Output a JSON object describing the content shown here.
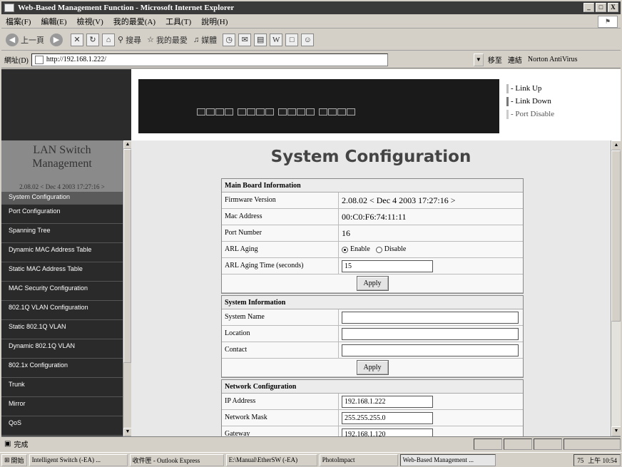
{
  "window": {
    "title": "Web-Based Management Function - Microsoft Internet Explorer",
    "controls": [
      "_",
      "□",
      "X"
    ]
  },
  "menu": [
    "檔案(F)",
    "編輯(E)",
    "檢視(V)",
    "我的最愛(A)",
    "工具(T)",
    "說明(H)"
  ],
  "toolbar": {
    "back": "上一頁",
    "search": "搜尋",
    "favorites": "我的最愛",
    "media": "媒體"
  },
  "address": {
    "label": "網址(D)",
    "url": "http://192.168.1.222/",
    "go": "移至",
    "links": "連結",
    "antivirus": "Norton AntiVirus"
  },
  "banner": {
    "legend": [
      "- Link Up",
      "- Link Down",
      "- Port Disable"
    ],
    "legend_colors": [
      "#cccccc",
      "#888888",
      "#bbbbbb"
    ]
  },
  "nav": {
    "title_line1": "LAN Switch",
    "title_line2": "Management",
    "version": "2.08.02 < Dec 4 2003 17:27:16 >",
    "items": [
      "System Configuration",
      "Port Configuration",
      "Spanning Tree",
      "Dynamic MAC Address Table",
      "Static MAC Address Table",
      "MAC Security Configuration",
      "802.1Q VLAN Configuration",
      "Static 802.1Q VLAN",
      "Dynamic 802.1Q VLAN",
      "802.1x Configuration",
      "Trunk",
      "Mirror",
      "QoS"
    ]
  },
  "main": {
    "title": "System Configuration",
    "board": {
      "header": "Main Board Information",
      "firmware_label": "Firmware Version",
      "firmware_value": "2.08.02 < Dec 4 2003 17:27:16 >",
      "mac_label": "Mac Address",
      "mac_value": "00:C0:F6:74:11:11",
      "ports_label": "Port Number",
      "ports_value": "16",
      "aging_label": "ARL Aging",
      "aging_enable": "Enable",
      "aging_disable": "Disable",
      "aging_selected": "Enable",
      "aging_time_label": "ARL Aging Time (seconds)",
      "aging_time_value": "15",
      "apply": "Apply"
    },
    "sysinfo": {
      "header": "System Information",
      "name_label": "System Name",
      "name_value": "",
      "location_label": "Location",
      "location_value": "",
      "contact_label": "Contact",
      "contact_value": "",
      "apply": "Apply"
    },
    "network": {
      "header": "Network Configuration",
      "ip_label": "IP Address",
      "ip_value": "192.168.1.222",
      "mask_label": "Network Mask",
      "mask_value": "255.255.255.0",
      "gateway_label": "Gateway",
      "gateway_value": "192.168.1.120"
    }
  },
  "status": {
    "text": "完成"
  },
  "taskbar": {
    "start": "開始",
    "tasks": [
      "Intelligent Switch (-EA) ...",
      "收件匣 - Outlook Express",
      "E:\\Manual\\EtherSW (-EA)",
      "PhotoImpact",
      "Web-Based Management ..."
    ],
    "tray_text": "75",
    "clock": "上午 10:54"
  }
}
